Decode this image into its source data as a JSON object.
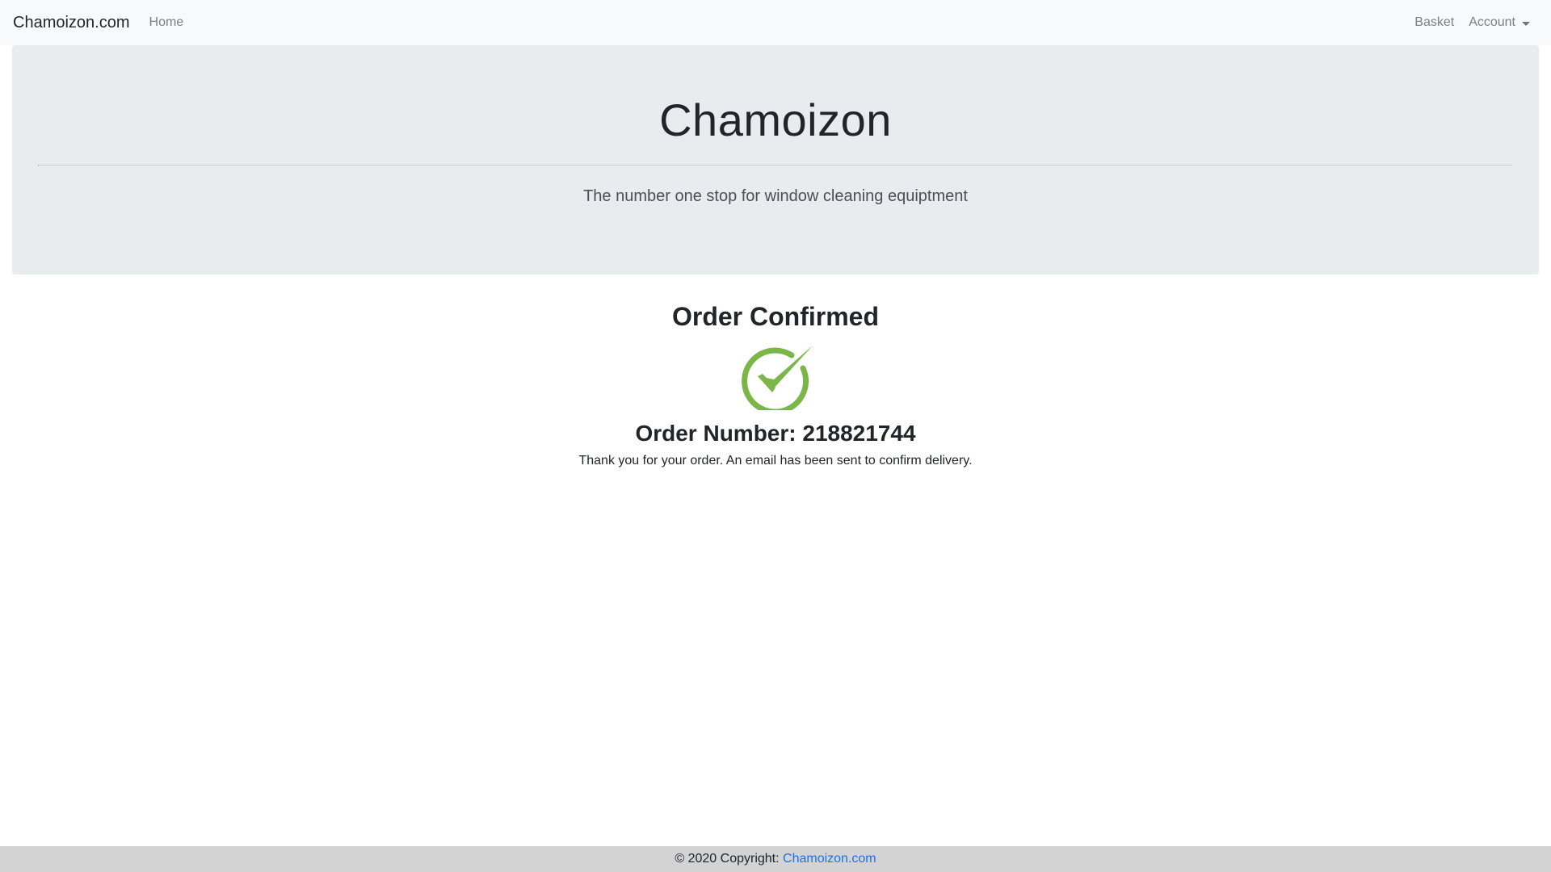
{
  "navbar": {
    "brand": "Chamoizon.com",
    "home": "Home",
    "basket": "Basket",
    "account": "Account"
  },
  "jumbotron": {
    "title": "Chamoizon",
    "lead": "The number one stop for window cleaning equiptment"
  },
  "confirmation": {
    "title": "Order Confirmed",
    "icon": "check-circle-icon",
    "icon_color": "#7ab648",
    "order_label": "Order Number: 218821744",
    "message": "Thank you for your order. An email has been sent to confirm delivery."
  },
  "footer": {
    "copyright": "© 2020 Copyright: ",
    "link": "Chamoizon.com",
    "link_color": "#1a73e8"
  }
}
